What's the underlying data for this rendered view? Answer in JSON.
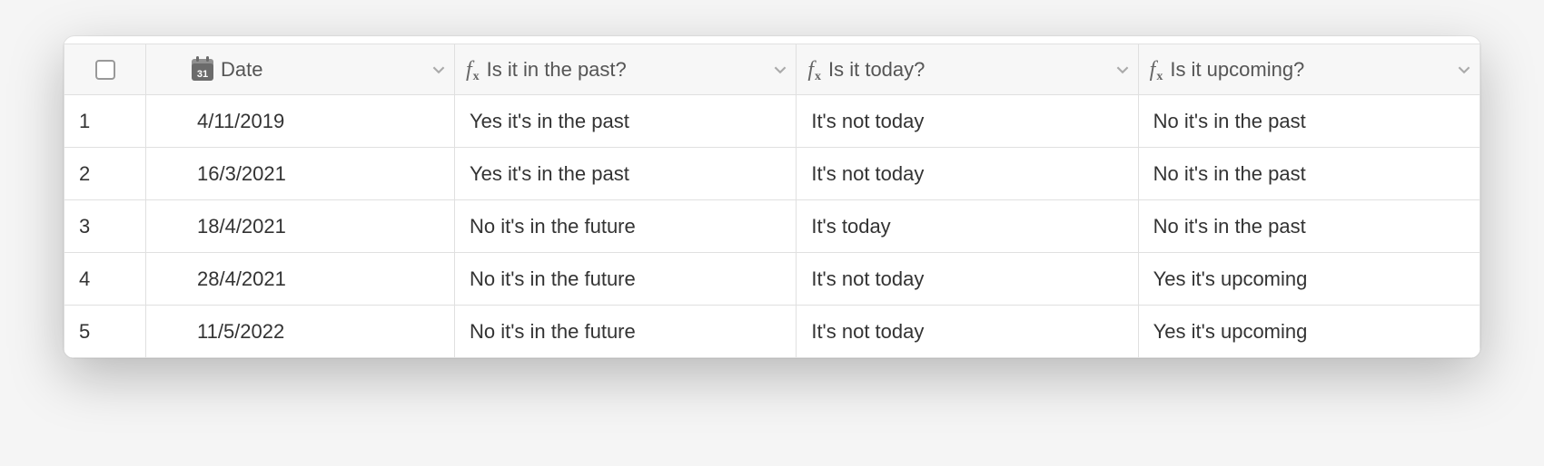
{
  "columns": {
    "date": {
      "label": "Date",
      "icon_text": "31"
    },
    "past": {
      "label": "Is it in the past?"
    },
    "today": {
      "label": "Is it today?"
    },
    "upcoming": {
      "label": "Is it upcoming?"
    }
  },
  "rows": [
    {
      "num": "1",
      "date": "4/11/2019",
      "past": "Yes it's in the past",
      "today": "It's not today",
      "upcoming": "No it's in the past"
    },
    {
      "num": "2",
      "date": "16/3/2021",
      "past": "Yes it's in the past",
      "today": "It's not today",
      "upcoming": "No it's in the past"
    },
    {
      "num": "3",
      "date": "18/4/2021",
      "past": "No it's in the future",
      "today": "It's today",
      "upcoming": "No it's in the past"
    },
    {
      "num": "4",
      "date": "28/4/2021",
      "past": "No it's in the future",
      "today": "It's not today",
      "upcoming": "Yes it's upcoming"
    },
    {
      "num": "5",
      "date": "11/5/2022",
      "past": "No it's in the future",
      "today": "It's not today",
      "upcoming": "Yes it's upcoming"
    }
  ]
}
